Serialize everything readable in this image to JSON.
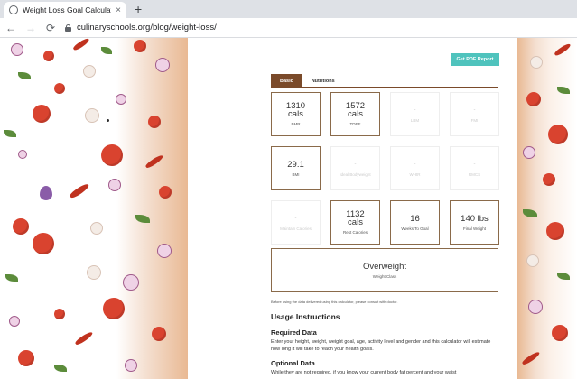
{
  "browser": {
    "tab_title": "Weight Loss Goal Calculator for",
    "tab_close": "×",
    "new_tab": "+",
    "url": "culinaryschools.org/blog/weight-loss/"
  },
  "calculator": {
    "pdf_button": "Get PDF Report",
    "tabs": [
      {
        "label": "Basic",
        "active": true
      },
      {
        "label": "Nutritions",
        "active": false
      }
    ],
    "cards": [
      {
        "value": "1310",
        "unit": "cals",
        "label": "BMR"
      },
      {
        "value": "1572",
        "unit": "cals",
        "label": "TDEE"
      },
      {
        "value": "-",
        "unit": "",
        "label": "LBM"
      },
      {
        "value": "-",
        "unit": "",
        "label": "FMI"
      },
      {
        "value": "29.1",
        "unit": "",
        "label": "BMI"
      },
      {
        "value": "-",
        "unit": "",
        "label": "Ideal Bodyweight"
      },
      {
        "value": "-",
        "unit": "",
        "label": "WHtR"
      },
      {
        "value": "-",
        "unit": "",
        "label": "RMCS"
      },
      {
        "value": "-",
        "unit": "",
        "label": "Maintain Calories"
      },
      {
        "value": "1132",
        "unit": "cals",
        "label": "Rest Calories"
      },
      {
        "value": "16",
        "unit": "",
        "label": "Weeks To Goal"
      },
      {
        "value": "140 lbs",
        "unit": "",
        "label": "Final Weight"
      }
    ],
    "weight_class": {
      "value": "Overweight",
      "label": "Weight Class"
    }
  },
  "content": {
    "disclaimer": "Before using the data delivered using this calculator, please consult with doctor.",
    "usage_heading": "Usage Instructions",
    "required_heading": "Required Data",
    "required_text": "Enter your height, weight, weight goal, age, activity level and gender and this calculator will estimate how long it will take to reach your health goals.",
    "optional_heading": "Optional Data",
    "optional_text": "While they are not required, if you know your current body fat percent and your waist"
  }
}
